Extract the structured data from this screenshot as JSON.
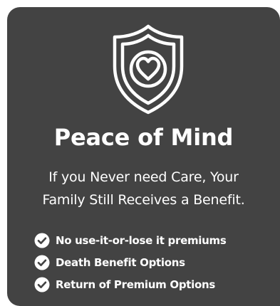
{
  "card": {
    "background_color": "#434343",
    "icon": "shield-heart-icon",
    "title": "Peace of Mind",
    "subtitle_lines": [
      "If you Never need Care, Your",
      "Family Still Receives a Benefit."
    ],
    "features": [
      {
        "icon": "check-circle-icon",
        "label": "No use-it-or-lose it premiums"
      },
      {
        "icon": "check-circle-icon",
        "label": "Death Benefit Options"
      },
      {
        "icon": "check-circle-icon",
        "label": "Return of Premium Options"
      }
    ]
  }
}
